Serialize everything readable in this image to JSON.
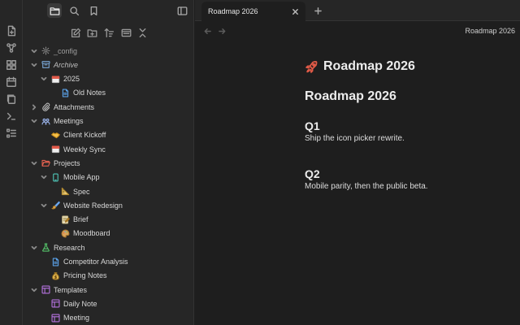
{
  "tab": {
    "title": "Roadmap 2026"
  },
  "view": {
    "title": "Roadmap 2026"
  },
  "note": {
    "inline_title": "Roadmap 2026",
    "heading1": "Roadmap 2026",
    "sections": [
      {
        "heading": "Q1",
        "text": "Ship the icon picker rewrite."
      },
      {
        "heading": "Q2",
        "text": "Mobile parity, then the public beta."
      }
    ]
  },
  "tree": [
    {
      "label": "_config",
      "depth": 0,
      "kind": "folder",
      "icon": "gear-icon",
      "expanded": true,
      "style": "muted"
    },
    {
      "label": "Archive",
      "depth": 0,
      "kind": "folder",
      "icon": "archive-box-icon",
      "expanded": true,
      "style": "italic"
    },
    {
      "label": "2025",
      "depth": 1,
      "kind": "folder",
      "icon": "calendar-icon",
      "expanded": true
    },
    {
      "label": "Old Notes",
      "depth": 2,
      "kind": "file",
      "icon": "file-icon"
    },
    {
      "label": "Attachments",
      "depth": 0,
      "kind": "folder",
      "icon": "paperclip-icon",
      "expanded": false
    },
    {
      "label": "Meetings",
      "depth": 0,
      "kind": "folder",
      "icon": "people-icon",
      "expanded": true
    },
    {
      "label": "Client Kickoff",
      "depth": 1,
      "kind": "file",
      "icon": "handshake-icon"
    },
    {
      "label": "Weekly Sync",
      "depth": 1,
      "kind": "file",
      "icon": "calendar-icon"
    },
    {
      "label": "Projects",
      "depth": 0,
      "kind": "folder",
      "icon": "folder-open-icon",
      "expanded": true
    },
    {
      "label": "Mobile App",
      "depth": 1,
      "kind": "folder",
      "icon": "phone-icon",
      "expanded": true
    },
    {
      "label": "Spec",
      "depth": 2,
      "kind": "file",
      "icon": "ruler-icon"
    },
    {
      "label": "Website Redesign",
      "depth": 1,
      "kind": "folder",
      "icon": "paintbrush-icon",
      "expanded": true
    },
    {
      "label": "Brief",
      "depth": 2,
      "kind": "file",
      "icon": "memo-icon"
    },
    {
      "label": "Moodboard",
      "depth": 2,
      "kind": "file",
      "icon": "palette-icon"
    },
    {
      "label": "Research",
      "depth": 0,
      "kind": "folder",
      "icon": "flask-icon",
      "expanded": true
    },
    {
      "label": "Competitor Analysis",
      "depth": 1,
      "kind": "file",
      "icon": "file-icon"
    },
    {
      "label": "Pricing Notes",
      "depth": 1,
      "kind": "file",
      "icon": "money-bag-icon"
    },
    {
      "label": "Templates",
      "depth": 0,
      "kind": "folder",
      "icon": "template-icon",
      "expanded": true
    },
    {
      "label": "Daily Note",
      "depth": 1,
      "kind": "file",
      "icon": "template-icon"
    },
    {
      "label": "Meeting",
      "depth": 1,
      "kind": "file",
      "icon": "template-icon"
    }
  ],
  "colors": {
    "accent": "#e05a47",
    "folder_red": "#e0604f",
    "file_blue": "#5aa0e6",
    "template_purple": "#b673e0",
    "research_green": "#55c46a"
  }
}
